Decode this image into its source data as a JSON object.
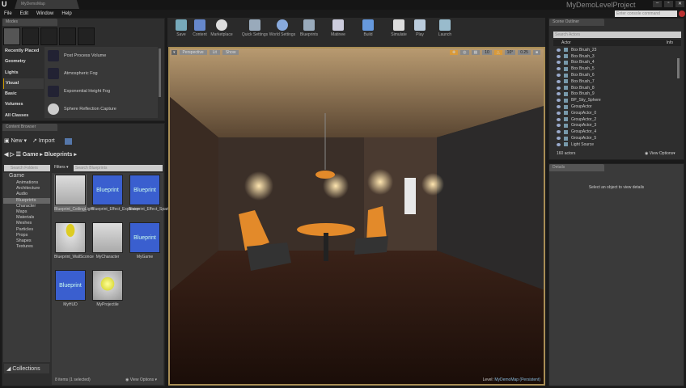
{
  "window": {
    "tab": "MyDemoMap",
    "project": "MyDemoLevelProject",
    "logo": "U",
    "min": "–",
    "max": "▫",
    "close": "✕"
  },
  "menu": [
    "File",
    "Edit",
    "Window",
    "Help"
  ],
  "console_placeholder": "Enter console command",
  "modes": {
    "tab": "Modes",
    "categories": [
      "Recently Placed",
      "Geometry",
      "Lights",
      "Visual",
      "Basic",
      "Volumes",
      "All Classes"
    ],
    "selected": "Visual",
    "items": [
      "Post Process Volume",
      "Atmospheric Fog",
      "Exponential Height Fog",
      "Sphere Reflection Capture"
    ]
  },
  "content_browser": {
    "tab": "Content Browser",
    "new": "New",
    "import": "Import",
    "path": [
      "Game",
      "Blueprints"
    ],
    "search_folders": "Search Folders",
    "filters": "Filters",
    "search_assets": "Search Blueprints",
    "folders": [
      "Game",
      "Animations",
      "Architecture",
      "Audio",
      "Blueprints",
      "Character",
      "Maps",
      "Materials",
      "Meshes",
      "Particles",
      "Props",
      "Shapes",
      "Textures"
    ],
    "selected_folder": "Blueprints",
    "assets": [
      {
        "name": "Blueprint_CeilingLight",
        "thumb": "light"
      },
      {
        "name": "Blueprint_Effect_Explosion",
        "thumb": "Blueprint"
      },
      {
        "name": "Blueprint_Effect_Sparks",
        "thumb": "Blueprint"
      },
      {
        "name": "Blueprint_WallSconce",
        "thumb": "sconce"
      },
      {
        "name": "MyCharacter",
        "thumb": "grid"
      },
      {
        "name": "MyGame",
        "thumb": "Blueprint"
      },
      {
        "name": "MyHUD",
        "thumb": "Blueprint"
      },
      {
        "name": "MyProjectile",
        "thumb": "ball"
      }
    ],
    "thumb_label": "Blueprint",
    "collections": "Collections",
    "count": "8 items (1 selected)",
    "view_options": "View Options"
  },
  "toolbar": [
    "Save",
    "Content",
    "Marketplace",
    "Quick Settings",
    "World Settings",
    "Blueprints",
    "Matinee",
    "Build",
    "Simulate",
    "Play",
    "Launch"
  ],
  "viewport": {
    "perspective": "Perspective",
    "lit": "Lit",
    "show": "Show",
    "grid": "10",
    "angle": "10°",
    "scale": "0.25",
    "level_label": "Level:",
    "level": "MyDemoMap (Persistent)"
  },
  "outliner": {
    "tab": "Scene Outliner",
    "search": "Search Actors",
    "col_actor": "Actor",
    "col_info": "Info",
    "rows": [
      "Box Brush_23",
      "Box Brush_3",
      "Box Brush_4",
      "Box Brush_5",
      "Box Brush_6",
      "Box Brush_7",
      "Box Brush_8",
      "Box Brush_9",
      "BP_Sky_Sphere",
      "GroupActor",
      "GroupActor_0",
      "GroupActor_2",
      "GroupActor_3",
      "GroupActor_4",
      "GroupActor_5",
      "Light Source"
    ],
    "count": "160 actors",
    "view_options": "View Options"
  },
  "details": {
    "tab": "Details",
    "empty": "Select an object to view details"
  }
}
